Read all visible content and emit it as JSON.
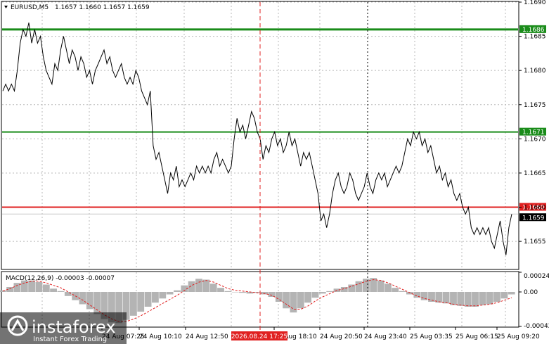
{
  "chart_data": [
    {
      "type": "line",
      "header": {
        "symbol_label": "EURUSD,M5",
        "ohlc": "1.1657 1.1660 1.1657 1.1659"
      },
      "ylim": [
        1.1651,
        1.169
      ],
      "grid": true,
      "y_ticks": [
        "1.1690",
        "1.1685",
        "1.1680",
        "1.1675",
        "1.1670",
        "1.1665",
        "1.1660",
        "1.1655"
      ],
      "x_ticks": [
        "24 Aug 07:25",
        "24 Aug 10:10",
        "24 Aug 12:50",
        "24 Aug 18:10",
        "24 Aug 20:50",
        "24 Aug 23:40",
        "25 Aug 03:35",
        "25 Aug 06:15",
        "25 Aug 09:20"
      ],
      "crosshair_label": "2026.08.24 17:25",
      "levels": [
        {
          "value": 1.1686,
          "label": "1.1686",
          "color": "#1a8c1a"
        },
        {
          "value": 1.1671,
          "label": "1.1671",
          "color": "#1a8c1a"
        },
        {
          "value": 1.166,
          "label": "1.1660",
          "color": "#e02020"
        },
        {
          "value": 1.1659,
          "label": "1.1659",
          "color": "#000000"
        }
      ],
      "price_series": [
        1.1677,
        1.1678,
        1.1677,
        1.1678,
        1.1677,
        1.168,
        1.1684,
        1.1686,
        1.1685,
        1.1687,
        1.1684,
        1.1686,
        1.1684,
        1.1685,
        1.1682,
        1.168,
        1.1679,
        1.1678,
        1.1681,
        1.168,
        1.1683,
        1.1685,
        1.1683,
        1.1681,
        1.1683,
        1.1682,
        1.168,
        1.1682,
        1.1681,
        1.1679,
        1.168,
        1.1678,
        1.168,
        1.1681,
        1.1682,
        1.1683,
        1.1681,
        1.1682,
        1.168,
        1.1679,
        1.168,
        1.1681,
        1.1679,
        1.1678,
        1.1679,
        1.1678,
        1.168,
        1.1679,
        1.1677,
        1.1676,
        1.1675,
        1.1677,
        1.1669,
        1.1667,
        1.1668,
        1.1666,
        1.1664,
        1.1662,
        1.1665,
        1.1664,
        1.1666,
        1.1663,
        1.1664,
        1.1663,
        1.1664,
        1.1665,
        1.1664,
        1.1666,
        1.1665,
        1.1666,
        1.1665,
        1.1666,
        1.1665,
        1.1667,
        1.1668,
        1.1666,
        1.1667,
        1.1666,
        1.1665,
        1.1666,
        1.167,
        1.1673,
        1.1671,
        1.1672,
        1.167,
        1.1672,
        1.1674,
        1.1673,
        1.1671,
        1.167,
        1.1667,
        1.1669,
        1.1668,
        1.167,
        1.1671,
        1.1669,
        1.167,
        1.1668,
        1.1669,
        1.1671,
        1.1669,
        1.167,
        1.1668,
        1.1666,
        1.1668,
        1.1667,
        1.1668,
        1.1666,
        1.1664,
        1.1662,
        1.1658,
        1.1659,
        1.1657,
        1.1659,
        1.1662,
        1.1664,
        1.1665,
        1.1663,
        1.1662,
        1.1663,
        1.1665,
        1.1664,
        1.1662,
        1.1661,
        1.1662,
        1.1663,
        1.1665,
        1.1663,
        1.1662,
        1.1664,
        1.1665,
        1.1664,
        1.1665,
        1.1663,
        1.1664,
        1.1665,
        1.1666,
        1.1665,
        1.1666,
        1.1668,
        1.167,
        1.1669,
        1.1671,
        1.167,
        1.1671,
        1.1669,
        1.167,
        1.1668,
        1.1669,
        1.1667,
        1.1665,
        1.1666,
        1.1664,
        1.1665,
        1.1663,
        1.1664,
        1.1662,
        1.1661,
        1.1662,
        1.166,
        1.1659,
        1.166,
        1.1657,
        1.1656,
        1.1657,
        1.1656,
        1.1657,
        1.1656,
        1.1657,
        1.1655,
        1.1654,
        1.1656,
        1.1658,
        1.1655,
        1.1653,
        1.1657,
        1.1659
      ],
      "macd": {
        "label": "MACD(12,26,9) -0.00003 -0.00007",
        "ylim": [
          -0.00042,
          0.00024
        ],
        "y_ticks": [
          "0.00024",
          "0.00",
          "-0.00042"
        ],
        "histogram": [
          2e-05,
          6e-05,
          0.00011,
          0.00014,
          0.00014,
          0.00012,
          9e-05,
          4e-05,
          1e-05,
          -5e-05,
          -0.0001,
          -0.00015,
          -0.00021,
          -0.00027,
          -0.00033,
          -0.00037,
          -0.00038,
          -0.00034,
          -0.00029,
          -0.00024,
          -0.00018,
          -0.00013,
          -8e-05,
          -3e-05,
          2e-05,
          8e-05,
          0.00013,
          0.00016,
          0.00015,
          0.0001,
          5e-05,
          1e-05,
          0.0,
          -1e-05,
          -2e-05,
          -1e-05,
          -3e-05,
          -6e-05,
          -0.00012,
          -0.0002,
          -0.00025,
          -0.0002,
          -0.00013,
          -7e-05,
          -2e-05,
          1e-05,
          4e-05,
          6e-05,
          9e-05,
          0.00013,
          0.00016,
          0.00017,
          0.00014,
          0.0001,
          5e-05,
          1e-05,
          -3e-05,
          -7e-05,
          -0.0001,
          -0.00012,
          -0.00013,
          -0.00014,
          -0.00016,
          -0.00017,
          -0.00018,
          -0.00018,
          -0.00016,
          -0.00015,
          -0.00012,
          -8e-05,
          -3e-05
        ],
        "signal": [
          1e-05,
          4e-05,
          8e-05,
          0.00011,
          0.00013,
          0.00013,
          0.00011,
          8e-05,
          5e-05,
          0.0,
          -5e-05,
          -0.0001,
          -0.00016,
          -0.00022,
          -0.00028,
          -0.00033,
          -0.00036,
          -0.00036,
          -0.00033,
          -0.00029,
          -0.00024,
          -0.00019,
          -0.00014,
          -9e-05,
          -4e-05,
          2e-05,
          8e-05,
          0.00012,
          0.00014,
          0.00012,
          8e-05,
          4e-05,
          2e-05,
          1e-05,
          0.0,
          -1e-05,
          -2e-05,
          -4e-05,
          -9e-05,
          -0.00015,
          -0.00021,
          -0.00021,
          -0.00017,
          -0.00011,
          -6e-05,
          -2e-05,
          2e-05,
          4e-05,
          7e-05,
          0.0001,
          0.00013,
          0.00015,
          0.00014,
          0.00011,
          7e-05,
          3e-05,
          -1e-05,
          -5e-05,
          -8e-05,
          -0.0001,
          -0.00012,
          -0.00013,
          -0.00015,
          -0.00016,
          -0.00017,
          -0.00017,
          -0.00016,
          -0.00015,
          -0.00013,
          -0.0001,
          -7e-05
        ]
      }
    }
  ],
  "watermark": {
    "brand": "instaforex",
    "tagline": "Instant Forex Trading"
  },
  "colors": {
    "price_line": "#000000",
    "grid": "#b8b8b8",
    "macd_histogram": "#b4b4b4",
    "macd_signal": "#e02020",
    "level_green": "#1a8c1a",
    "level_red": "#e02020",
    "crosshair": "#e02020"
  }
}
